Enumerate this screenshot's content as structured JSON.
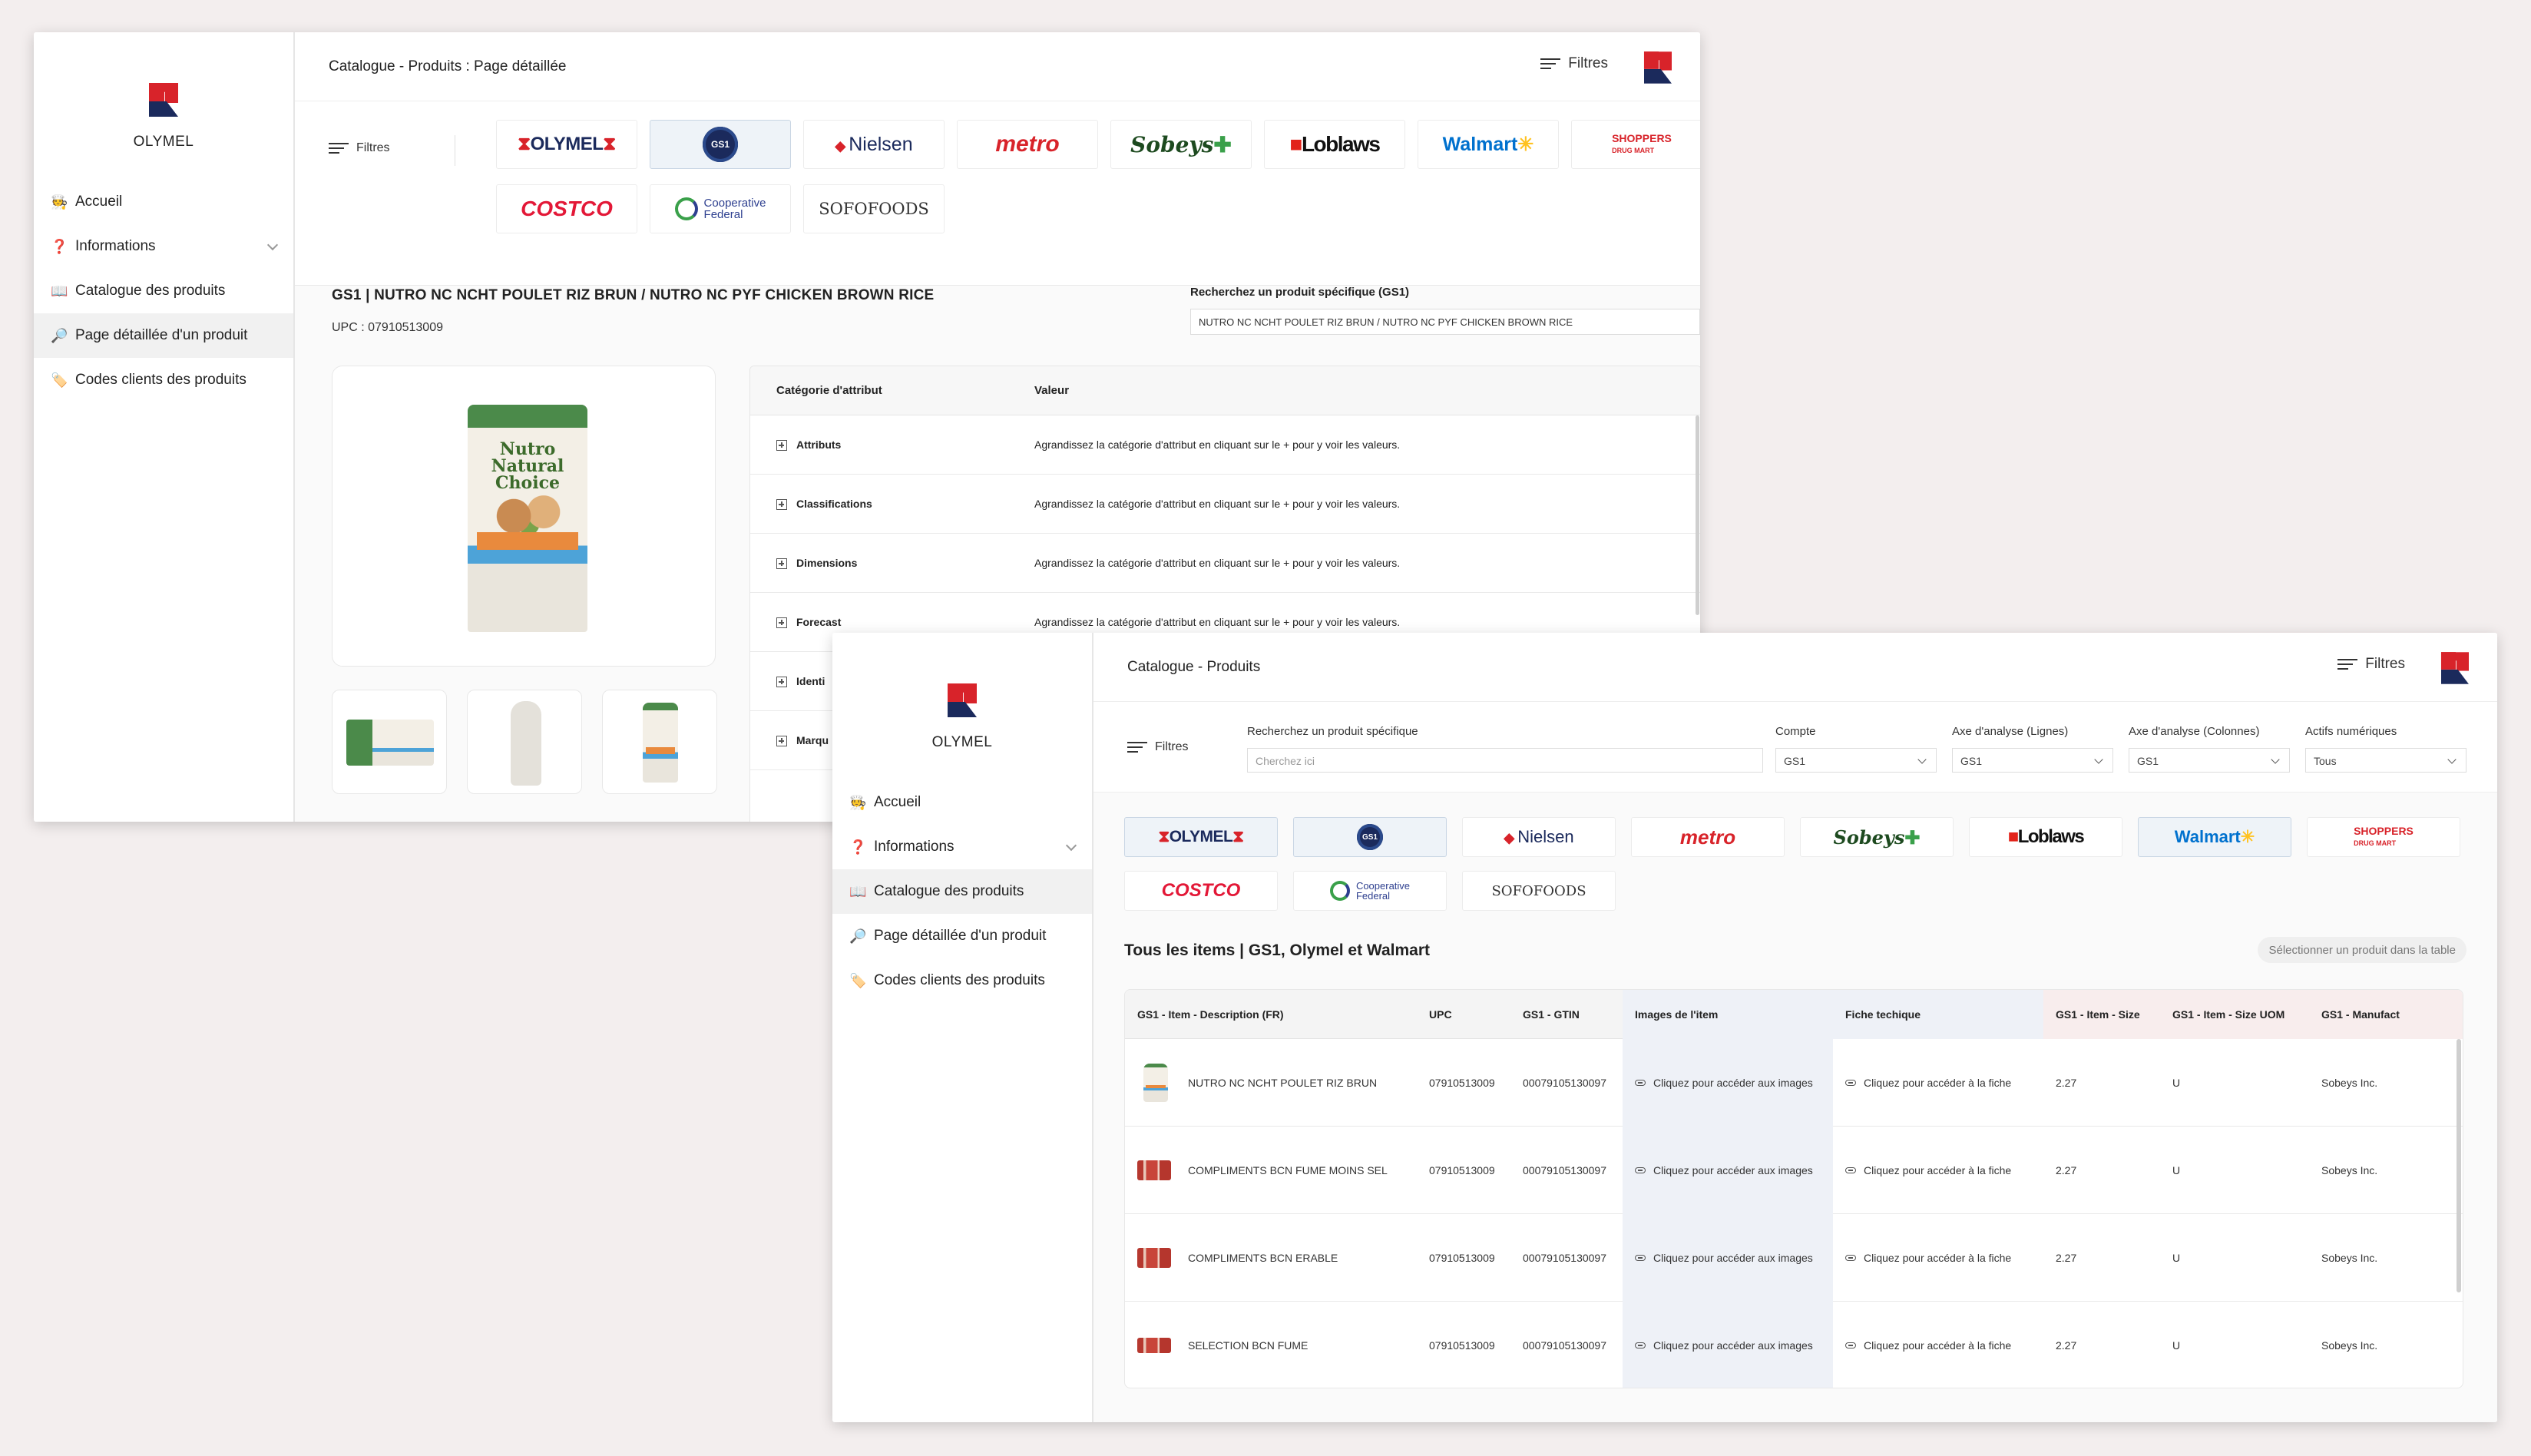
{
  "brand": {
    "name": "OLYMEL"
  },
  "nav": [
    {
      "icon": "🧑‍🍳",
      "label": "Accueil"
    },
    {
      "icon": "❓",
      "label": "Informations"
    },
    {
      "icon": "📖",
      "label": "Catalogue des produits"
    },
    {
      "icon": "🔎",
      "label": "Page détaillée d'un produit"
    },
    {
      "icon": "🏷️",
      "label": "Codes clients des produits"
    }
  ],
  "filters_label": "Filtres",
  "logos": {
    "olymel": "OLYMEL",
    "gs1": "GS1",
    "nielsen": "Nielsen",
    "metro": "metro",
    "sobeys": "Sobeys",
    "loblaws": "Loblaws",
    "walmart": "Walmart",
    "shoppers_1": "SHOPPERS",
    "shoppers_2": "DRUG MART",
    "costco": "COSTCO",
    "coop_1": "Cooperative",
    "coop_2": "Federal",
    "sofo": "SOFOFOODS"
  },
  "detail": {
    "breadcrumb": "Catalogue - Produits : Page détaillée",
    "heading": "GS1  |  NUTRO NC NCHT POULET RIZ BRUN / NUTRO NC PYF CHICKEN BROWN RICE",
    "upc": "UPC : 07910513009",
    "search_label": "Recherchez un produit spécifique (GS1)",
    "search_value": "NUTRO NC NCHT POULET RIZ BRUN / NUTRO NC PYF CHICKEN BROWN RICE",
    "product_brand_line1": "Nutro",
    "product_brand_line2": "Natural",
    "product_brand_line3": "Choice",
    "attr_col1": "Catégorie d'attribut",
    "attr_col2": "Valeur",
    "attr_hint": "Agrandissez la catégorie d'attribut en cliquant sur le + pour y voir les valeurs.",
    "attributes": [
      "Attributs",
      "Classifications",
      "Dimensions",
      "Forecast",
      "Identi",
      "Marqu"
    ]
  },
  "catalogue": {
    "breadcrumb": "Catalogue - Produits",
    "search_label": "Recherchez un produit spécifique",
    "search_placeholder": "Cherchez ici",
    "compte_label": "Compte",
    "compte_value": "GS1",
    "axe_lignes_label": "Axe d'analyse (Lignes)",
    "axe_lignes_value": "GS1",
    "axe_colonnes_label": "Axe d'analyse (Colonnes)",
    "axe_colonnes_value": "GS1",
    "actifs_label": "Actifs numériques",
    "actifs_value": "Tous",
    "section_title": "Tous les items  |  GS1, Olymel et Walmart",
    "select_pill": "Sélectionner un produit dans la table",
    "columns": [
      "GS1 - Item - Description (FR)",
      "UPC",
      "GS1 - GTIN",
      "Images de l'item",
      "Fiche techique",
      "GS1 - Item - Size",
      "GS1 - Item - Size UOM",
      "GS1 - Manufact"
    ],
    "rows": [
      {
        "desc": "NUTRO NC NCHT POULET RIZ BRUN",
        "upc": "07910513009",
        "gtin": "00079105130097",
        "images": "Cliquez pour accéder aux images",
        "fiche": "Cliquez pour accéder à la fiche",
        "size": "2.27",
        "uom": "U",
        "manu": "Sobeys Inc."
      },
      {
        "desc": "COMPLIMENTS BCN FUME MOINS SEL",
        "upc": "07910513009",
        "gtin": "00079105130097",
        "images": "Cliquez pour accéder aux images",
        "fiche": "Cliquez pour accéder à la fiche",
        "size": "2.27",
        "uom": "U",
        "manu": "Sobeys Inc."
      },
      {
        "desc": "COMPLIMENTS BCN ERABLE",
        "upc": "07910513009",
        "gtin": "00079105130097",
        "images": "Cliquez pour accéder aux images",
        "fiche": "Cliquez pour accéder à la fiche",
        "size": "2.27",
        "uom": "U",
        "manu": "Sobeys Inc."
      },
      {
        "desc": "SELECTION BCN FUME",
        "upc": "07910513009",
        "gtin": "00079105130097",
        "images": "Cliquez pour accéder aux images",
        "fiche": "Cliquez pour accéder à la fiche",
        "size": "2.27",
        "uom": "U",
        "manu": "Sobeys Inc."
      }
    ]
  },
  "colors": {
    "brand_red": "#d8232a",
    "brand_navy": "#1b2a5c",
    "selected_tile": "#eef3f8",
    "col_tint_blue": "#eef1f7",
    "col_tint_pink": "#f8eded"
  }
}
